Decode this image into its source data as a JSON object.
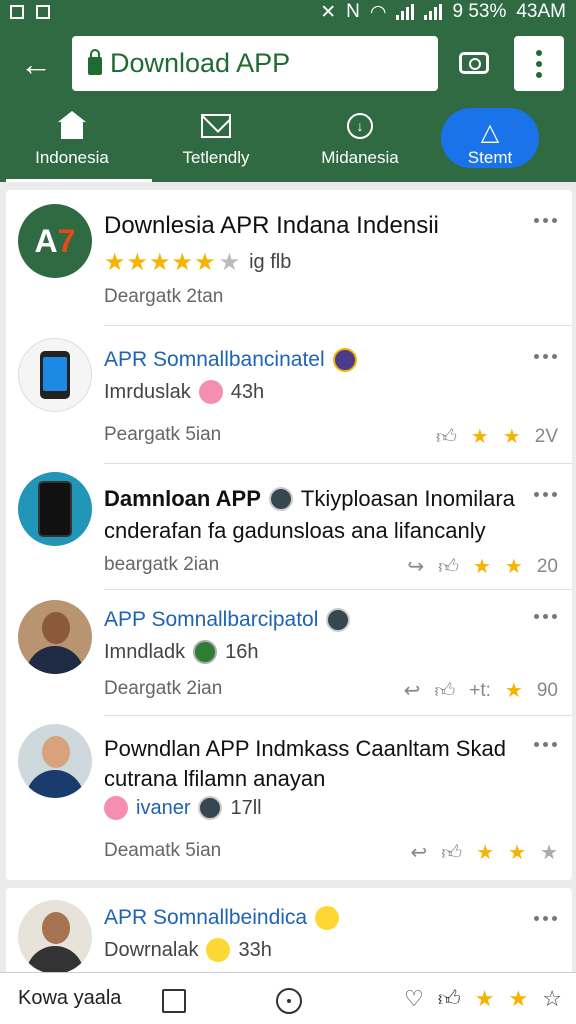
{
  "status_bar": {
    "right_text": "9 53%",
    "time": "43AM"
  },
  "toolbar": {
    "url": "Download APP"
  },
  "tabs": [
    {
      "label": "Indonesia",
      "icon": "home-icon"
    },
    {
      "label": "Tetlendly",
      "icon": "mail-icon"
    },
    {
      "label": "Midanesia",
      "icon": "download-icon"
    },
    {
      "label": "Stemt",
      "icon": "send-icon"
    }
  ],
  "items": [
    {
      "title": "Downlesia APR Indana Indensii",
      "rating_text": "ig f​lb",
      "meta": "Deargatk 2tan",
      "stars": "★★★★★",
      "stars_off": "★"
    },
    {
      "title": "APR Somnallbancinatel",
      "sub": "Imrduslak",
      "sub_time": "43h",
      "meta": "Peargatk 5ian",
      "count": "2V"
    },
    {
      "title": "Damnloan APP",
      "title_rest": "Tkiyploasan Inomilara",
      "title_line2": "cnderafan fa gadunsloas  ana lifancanly",
      "meta": "beargatk 2ian",
      "count": "20"
    },
    {
      "title": "APP Somnallbarcipatol",
      "sub": "Imndladk",
      "sub_time": "16h",
      "meta": "Deargatk 2ian",
      "action_text": "+t:",
      "count": "90"
    },
    {
      "title": "Powndlan APP Indmkass Caanltam Skad",
      "title_line2": "cutrana lfilamn anayan",
      "sub": "ivaner",
      "sub_time": "17ll",
      "meta": "Deamatk 5ian"
    },
    {
      "title": "APR Somnallbeindica",
      "sub": "Dowrnalak",
      "sub_time": "33h"
    }
  ],
  "bottom": {
    "label": "Kowa yaala"
  }
}
